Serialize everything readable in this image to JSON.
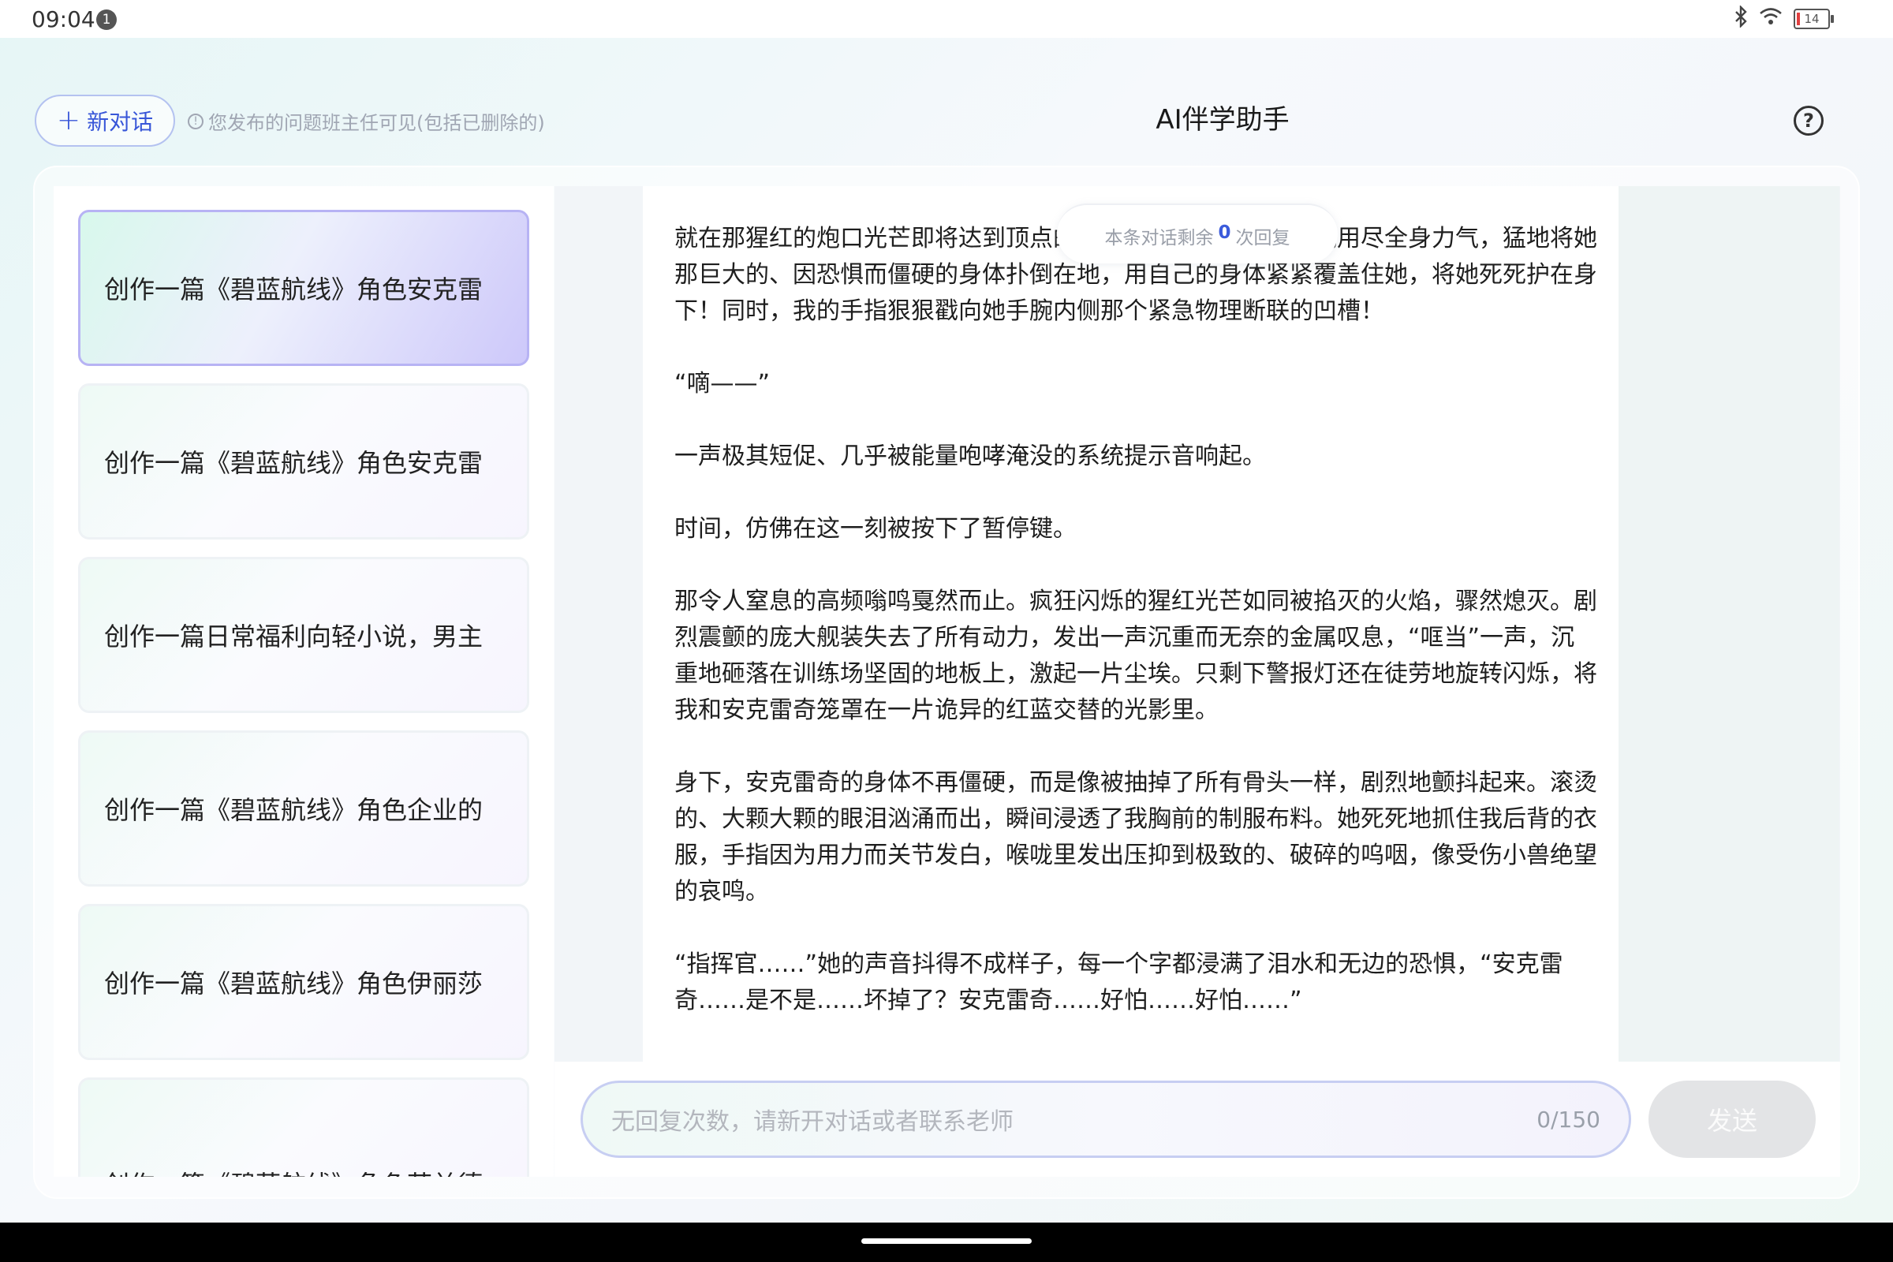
{
  "status_bar": {
    "time": "09:04",
    "notification_count": "1",
    "battery": "14"
  },
  "header": {
    "new_chat_label": "新对话",
    "notice": "您发布的问题班主任可见(包括已删除的)",
    "title": "AI伴学助手"
  },
  "sidebar": {
    "items": [
      {
        "label": "创作一篇《碧蓝航线》角色安克雷"
      },
      {
        "label": "创作一篇《碧蓝航线》角色安克雷"
      },
      {
        "label": "创作一篇日常福利向轻小说，男主"
      },
      {
        "label": "创作一篇《碧蓝航线》角色企业的"
      },
      {
        "label": "创作一篇《碧蓝航线》角色伊丽莎"
      },
      {
        "label": "创作一篇《碧蓝航线》角色芙兰德"
      }
    ]
  },
  "chat": {
    "remaining_prefix": "本条对话剩余",
    "remaining_count": "0",
    "remaining_suffix": "次回复",
    "paragraphs": [
      "就在那猩红的炮口光芒即将达到顶点的瞬间，没有丝毫犹豫，我用尽全身力气，猛地将她那巨大的、因恐惧而僵硬的身体扑倒在地，用自己的身体紧紧覆盖住她，将她死死护在身下！同时，我的手指狠狠戳向她手腕内侧那个紧急物理断联的凹槽！",
      "“嘀——”",
      "一声极其短促、几乎被能量咆哮淹没的系统提示音响起。",
      "时间，仿佛在这一刻被按下了暂停键。",
      "那令人窒息的高频嗡鸣戛然而止。疯狂闪烁的猩红光芒如同被掐灭的火焰，骤然熄灭。剧烈震颤的庞大舰装失去了所有动力，发出一声沉重而无奈的金属叹息，“哐当”一声，沉重地砸落在训练场坚固的地板上，激起一片尘埃。只剩下警报灯还在徒劳地旋转闪烁，将我和安克雷奇笼罩在一片诡异的红蓝交替的光影里。",
      "身下，安克雷奇的身体不再僵硬，而是像被抽掉了所有骨头一样，剧烈地颤抖起来。滚烫的、大颗大颗的眼泪汹涌而出，瞬间浸透了我胸前的制服布料。她死死地抓住我后背的衣服，手指因为用力而关节发白，喉咙里发出压抑到极致的、破碎的呜咽，像受伤小兽绝望的哀鸣。",
      "“指挥官……”她的声音抖得不成样子，每一个字都浸满了泪水和无边的恐惧，“安克雷奇……是不是……坏掉了？安克雷奇……好怕……好怕……”"
    ]
  },
  "input": {
    "placeholder": "无回复次数，请新开对话或者联系老师",
    "counter": "0/150",
    "send_label": "发送"
  }
}
